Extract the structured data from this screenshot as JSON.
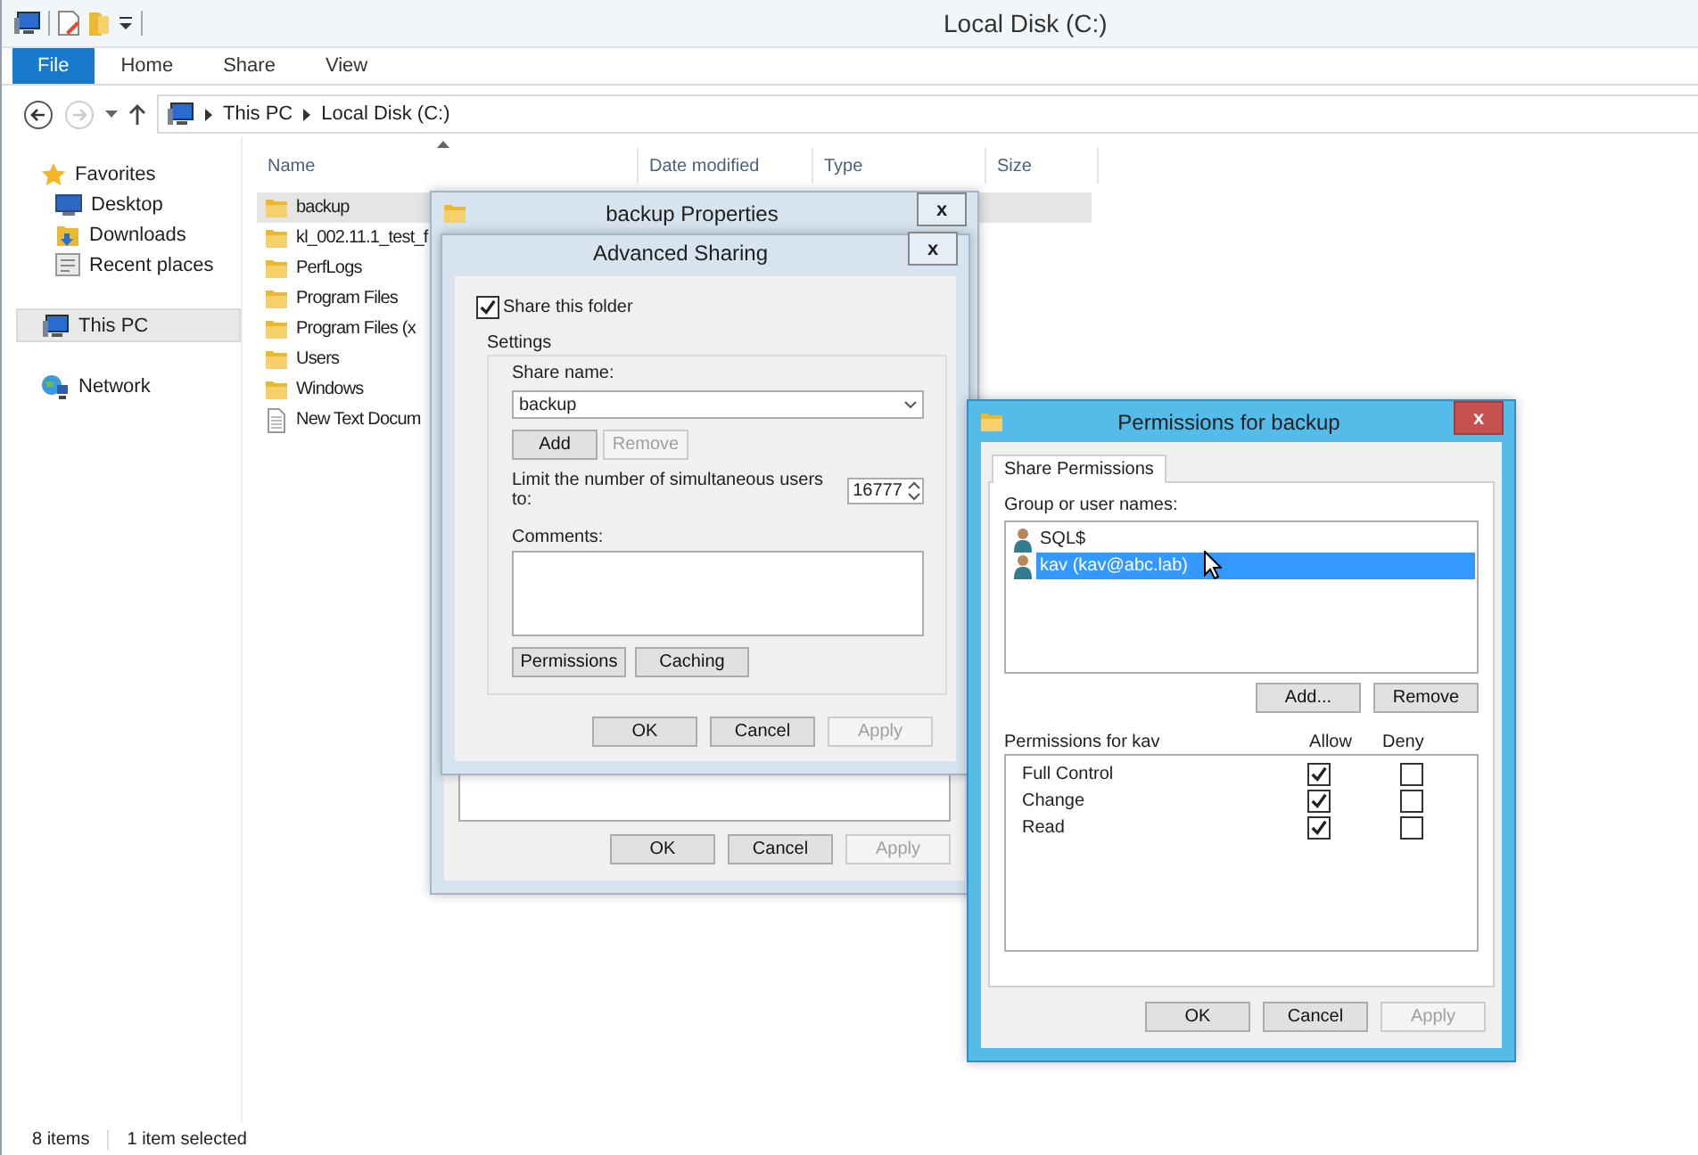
{
  "window": {
    "title": "Local Disk (C:)"
  },
  "ribbon_tabs": [
    {
      "label": "File",
      "kind": "menu"
    },
    {
      "label": "Home",
      "kind": "tab"
    },
    {
      "label": "Share",
      "kind": "tab"
    },
    {
      "label": "View",
      "kind": "tab"
    }
  ],
  "address_bar": {
    "path": [
      "This PC",
      "Local Disk (C:)"
    ]
  },
  "nav": {
    "items": [
      {
        "label": "Favorites",
        "kind": "star",
        "selected": false,
        "children": [
          {
            "label": "Desktop",
            "kind": "desktop",
            "selected": false
          },
          {
            "label": "Downloads",
            "kind": "downloads",
            "selected": false
          },
          {
            "label": "Recent places",
            "kind": "recent",
            "selected": false
          }
        ]
      },
      {
        "label": "This PC",
        "kind": "pc",
        "selected": true
      },
      {
        "label": "Network",
        "kind": "network",
        "selected": false
      }
    ]
  },
  "file_list": {
    "columns": [
      "Name",
      "Date modified",
      "Type",
      "Size"
    ],
    "rows": [
      {
        "name": "backup",
        "kind": "folder",
        "selected": true
      },
      {
        "name": "kl_002.11.1_test_f",
        "kind": "folder",
        "selected": false
      },
      {
        "name": "PerfLogs",
        "kind": "folder",
        "selected": false
      },
      {
        "name": "Program Files",
        "kind": "folder",
        "selected": false
      },
      {
        "name": "Program Files (x",
        "kind": "folder",
        "selected": false
      },
      {
        "name": "Users",
        "kind": "folder",
        "selected": false
      },
      {
        "name": "Windows",
        "kind": "folder",
        "selected": false
      },
      {
        "name": "New Text Docum",
        "kind": "file",
        "selected": false
      }
    ]
  },
  "status_bar": {
    "count": "8 items",
    "selection": "1 item selected"
  },
  "properties_dialog": {
    "title": "backup Properties",
    "close": "x",
    "buttons": [
      {
        "label": "OK",
        "disabled": false
      },
      {
        "label": "Cancel",
        "disabled": false
      },
      {
        "label": "Apply",
        "disabled": true
      }
    ]
  },
  "advanced_sharing": {
    "title": "Advanced Sharing",
    "close": "x",
    "share_checkbox": {
      "label": "Share this folder",
      "checked": true
    },
    "group_label": "Settings",
    "share_name_label": "Share name:",
    "share_name": "backup",
    "name_buttons": [
      {
        "label": "Add",
        "disabled": false
      },
      {
        "label": "Remove",
        "disabled": true
      }
    ],
    "limit_label": "Limit the number of simultaneous users to:",
    "limit_value": "16777",
    "comments_label": "Comments:",
    "option_buttons": [
      {
        "label": "Permissions",
        "disabled": false
      },
      {
        "label": "Caching",
        "disabled": false
      }
    ],
    "buttons": [
      {
        "label": "OK",
        "disabled": false
      },
      {
        "label": "Cancel",
        "disabled": false
      },
      {
        "label": "Apply",
        "disabled": true
      }
    ]
  },
  "permissions_dialog": {
    "title": "Permissions for backup",
    "close": "x",
    "tabs": [
      {
        "label": "Share Permissions",
        "selected": true
      }
    ],
    "users_label": "Group or user names:",
    "users": [
      {
        "name": "SQL$",
        "selected": false
      },
      {
        "name": "kav (kav@abc.lab)",
        "selected": true
      }
    ],
    "user_buttons": [
      {
        "label": "Add...",
        "disabled": false
      },
      {
        "label": "Remove",
        "disabled": false
      }
    ],
    "permissions_label": "Permissions for kav",
    "allow_label": "Allow",
    "deny_label": "Deny",
    "permissions": [
      {
        "name": "Full Control",
        "allow": true,
        "deny": false
      },
      {
        "name": "Change",
        "allow": true,
        "deny": false
      },
      {
        "name": "Read",
        "allow": true,
        "deny": false
      }
    ],
    "buttons": [
      {
        "label": "OK",
        "disabled": false
      },
      {
        "label": "Cancel",
        "disabled": false
      },
      {
        "label": "Apply",
        "disabled": true
      }
    ]
  }
}
